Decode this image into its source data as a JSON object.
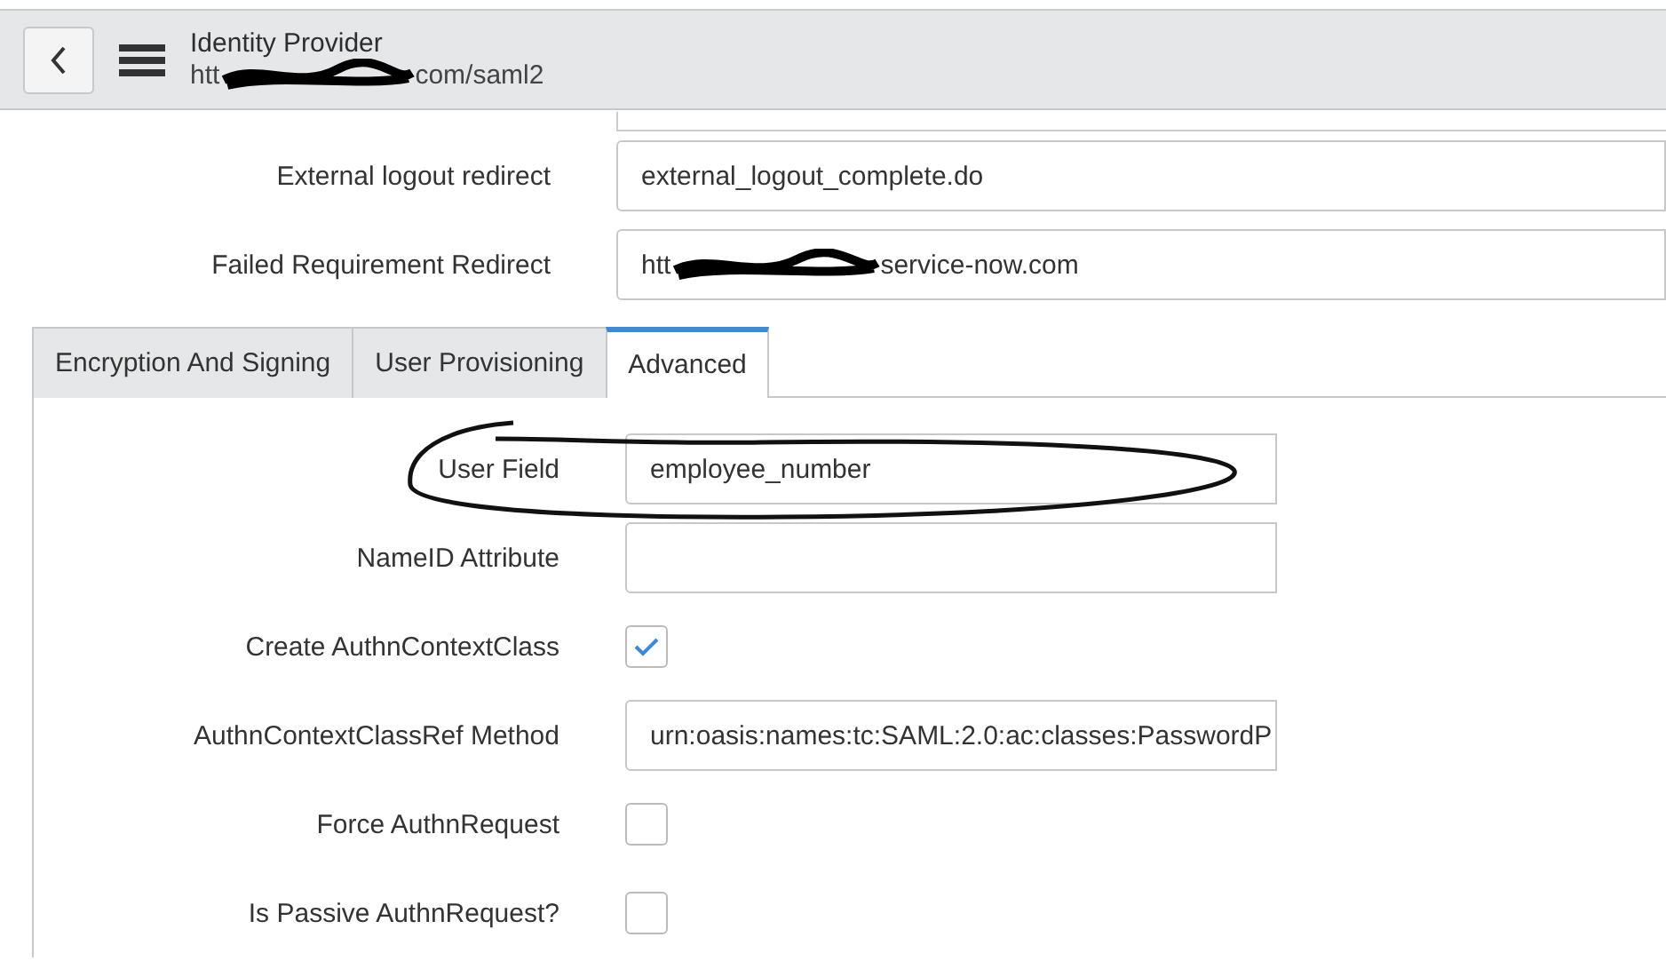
{
  "header": {
    "title": "Identity Provider",
    "url_start": "htt",
    "url_end": "com/saml2",
    "url_redacted": true
  },
  "fields": [
    {
      "label": "External logout redirect",
      "value": "external_logout_complete.do"
    },
    {
      "label": "Failed Requirement Redirect",
      "value_start": "htt",
      "value": "service-now.com",
      "redacted": true
    }
  ],
  "tabs": [
    {
      "label": "Encryption And Signing",
      "selected": false
    },
    {
      "label": "User Provisioning",
      "selected": false
    },
    {
      "label": "Advanced",
      "selected": true
    }
  ],
  "advanced": [
    {
      "kind": "text",
      "label": "User Field",
      "value": "employee_number",
      "circled": true
    },
    {
      "kind": "text",
      "label": "NameID Attribute"
    },
    {
      "kind": "checkbox",
      "label": "Create AuthnContextClass",
      "checked": true
    },
    {
      "kind": "text",
      "label": "AuthnContextClassRef Method",
      "value": "urn:oasis:names:tc:SAML:2.0:ac:classes:PasswordP"
    },
    {
      "kind": "checkbox",
      "label": "Force AuthnRequest",
      "checked": false
    },
    {
      "kind": "checkbox",
      "label": "Is Passive AuthnRequest?",
      "checked": false
    }
  ]
}
